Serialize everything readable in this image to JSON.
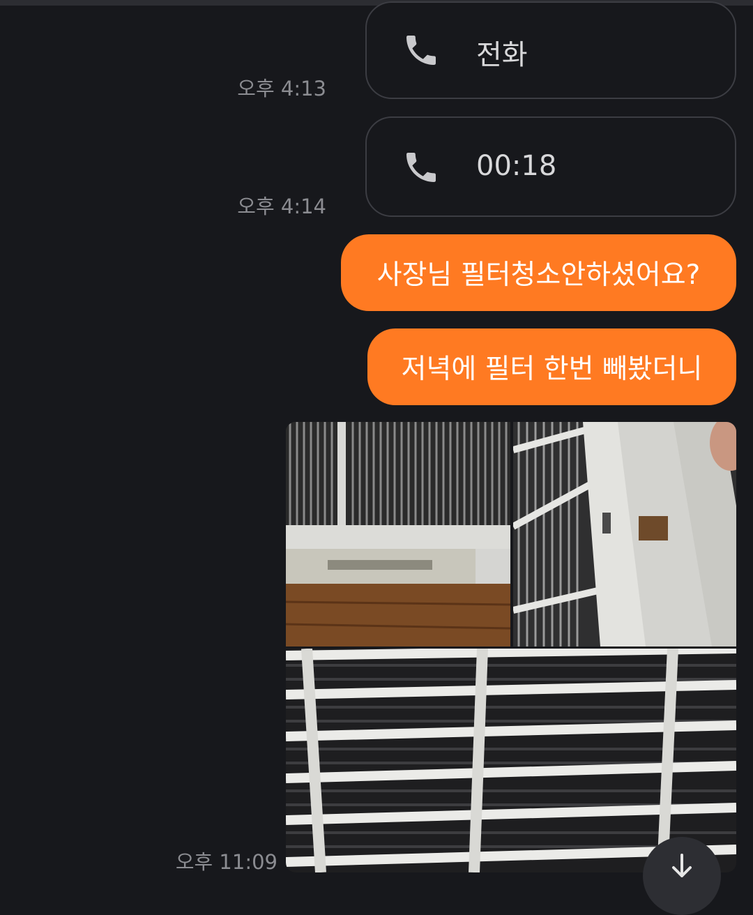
{
  "calls": [
    {
      "label": "전화",
      "time": "오후 4:13",
      "icon": "phone-icon"
    },
    {
      "label": "00:18",
      "time": "오후 4:14",
      "icon": "phone-icon"
    }
  ],
  "messages": [
    {
      "text": "사장님 필터청소안하셨어요?"
    },
    {
      "text": "저녁에 필터 한번 빼봤더니"
    }
  ],
  "photo_group": {
    "time": "오후 11:09",
    "photos": [
      {
        "subject": "air filter frame on wooden floor"
      },
      {
        "subject": "filter frame held by hand"
      },
      {
        "subject": "close-up of dusty filter grille"
      }
    ]
  },
  "scroll_button": {
    "icon": "arrow-down-icon"
  },
  "colors": {
    "background": "#17181c",
    "bubble": "#ff7a22",
    "card_border": "#3c3d43",
    "timestamp": "#8b8c91"
  }
}
